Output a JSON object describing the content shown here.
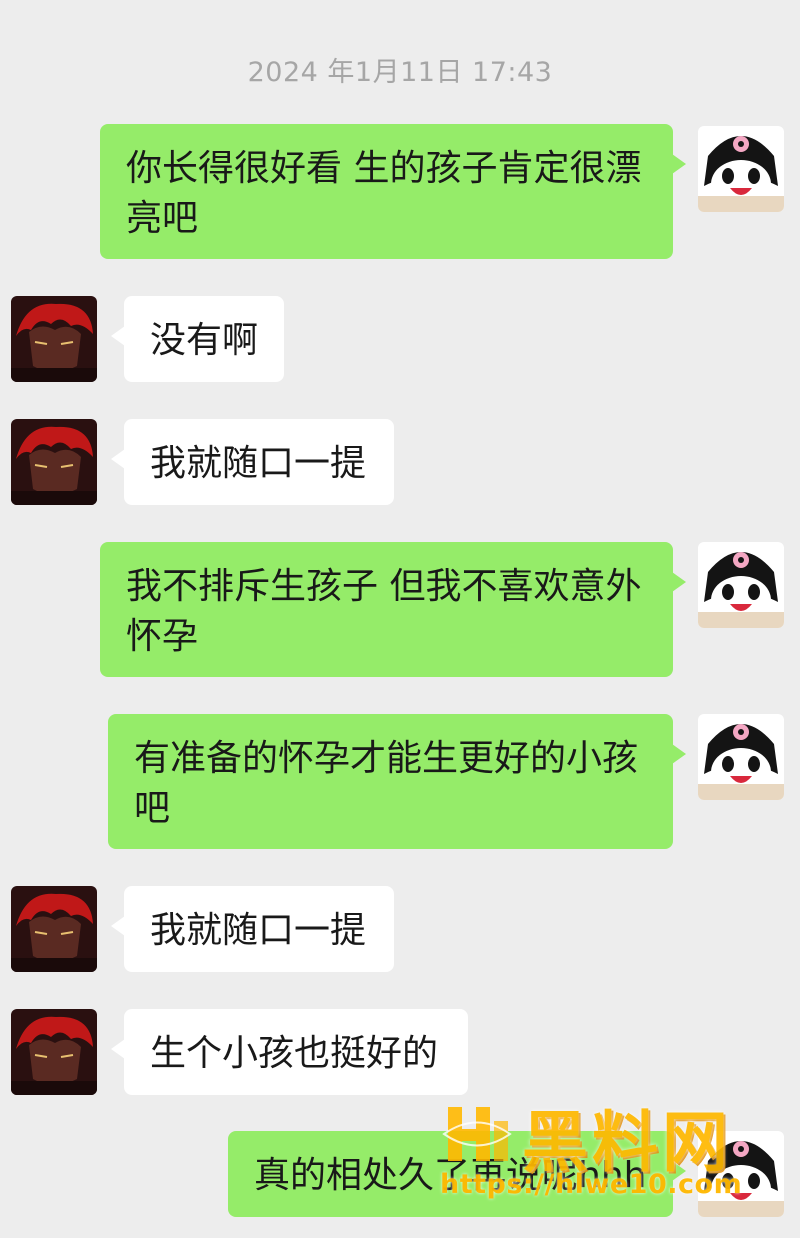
{
  "timestamp": "2024 年1月11日 17:43",
  "messages": [
    {
      "side": "out",
      "text": "你长得很好看 生的孩子肯定很漂亮吧"
    },
    {
      "side": "in",
      "text": "没有啊"
    },
    {
      "side": "in",
      "text": "我就随口一提"
    },
    {
      "side": "out",
      "text": "我不排斥生孩子 但我不喜欢意外怀孕"
    },
    {
      "side": "out",
      "text": "有准备的怀孕才能生更好的小孩吧"
    },
    {
      "side": "in",
      "text": "我就随口一提"
    },
    {
      "side": "in",
      "text": "生个小孩也挺好的"
    },
    {
      "side": "out",
      "text": "真的相处久了再说呢hhh"
    }
  ],
  "watermark": {
    "title": "黑料网",
    "url": "https://hlwe10.com"
  },
  "colors": {
    "background": "#ededed",
    "outgoing_bubble": "#95ec69",
    "incoming_bubble": "#ffffff",
    "watermark": "#ffb800"
  }
}
